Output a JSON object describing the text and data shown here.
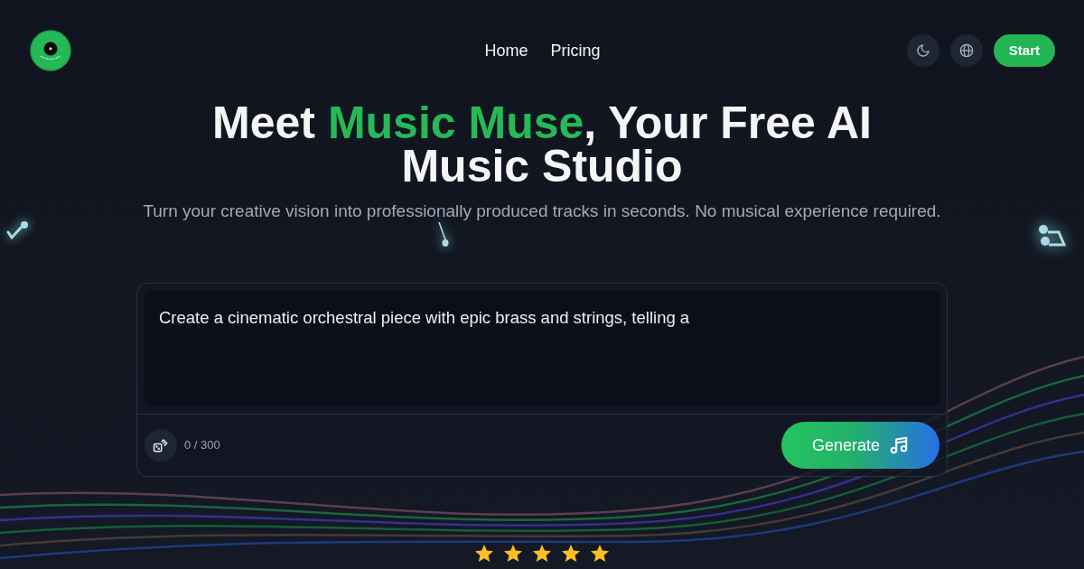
{
  "header": {
    "nav": [
      {
        "label": "Home"
      },
      {
        "label": "Pricing"
      }
    ],
    "start_button": {
      "label": "Start"
    }
  },
  "hero": {
    "title": [
      {
        "text": "Meet ",
        "highlight": false
      },
      {
        "text": "Music Muse",
        "highlight": true
      },
      {
        "text": ", Your Free AI Music Studio",
        "highlight": false
      }
    ],
    "subtitle": "Turn your creative vision into professionally produced tracks in seconds. No musical experience required."
  },
  "prompt": {
    "placeholder": "Create a cinematic orchestral piece with epic brass and strings, telling a",
    "counter": "0 / 300",
    "generate_button": {
      "label": "Generate"
    }
  },
  "rating": {
    "stars": 5
  }
}
